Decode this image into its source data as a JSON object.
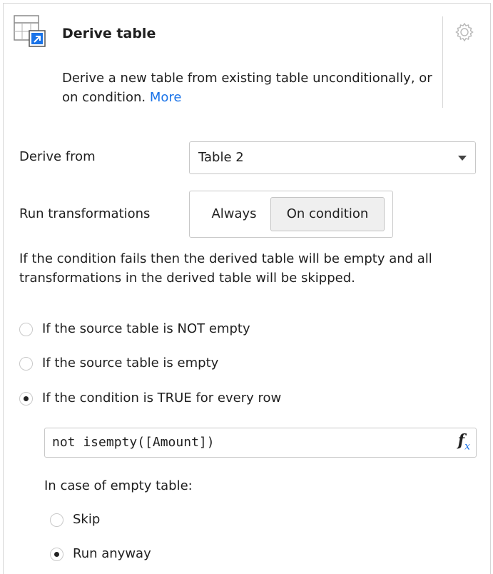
{
  "header": {
    "icon": "derive-table-icon",
    "title": "Derive table",
    "description": "Derive a new table from existing table unconditionally, or on condition.",
    "more_link": "More",
    "settings_icon": "gear-icon"
  },
  "derive_from": {
    "label": "Derive from",
    "selected": "Table 2"
  },
  "run_transformations": {
    "label": "Run transformations",
    "options": [
      "Always",
      "On condition"
    ],
    "selected": "On condition"
  },
  "info_text": "If the condition fails then the derived table will be empty and all transformations in the derived table will be skipped.",
  "conditions": [
    {
      "label": "If the source table is NOT empty",
      "checked": false
    },
    {
      "label": "If the source table is empty",
      "checked": false
    },
    {
      "label": "If the condition is TRUE for every row",
      "checked": true
    }
  ],
  "formula": {
    "value": "not isempty([Amount])",
    "fx_label": "f",
    "fx_sub": "x"
  },
  "empty_table": {
    "label": "In case of empty table:",
    "options": [
      {
        "label": "Skip",
        "checked": false
      },
      {
        "label": "Run anyway",
        "checked": true
      }
    ]
  },
  "colors": {
    "link": "#1a73e8",
    "border": "#c8c8c8",
    "selected_segment": "#efefef"
  }
}
